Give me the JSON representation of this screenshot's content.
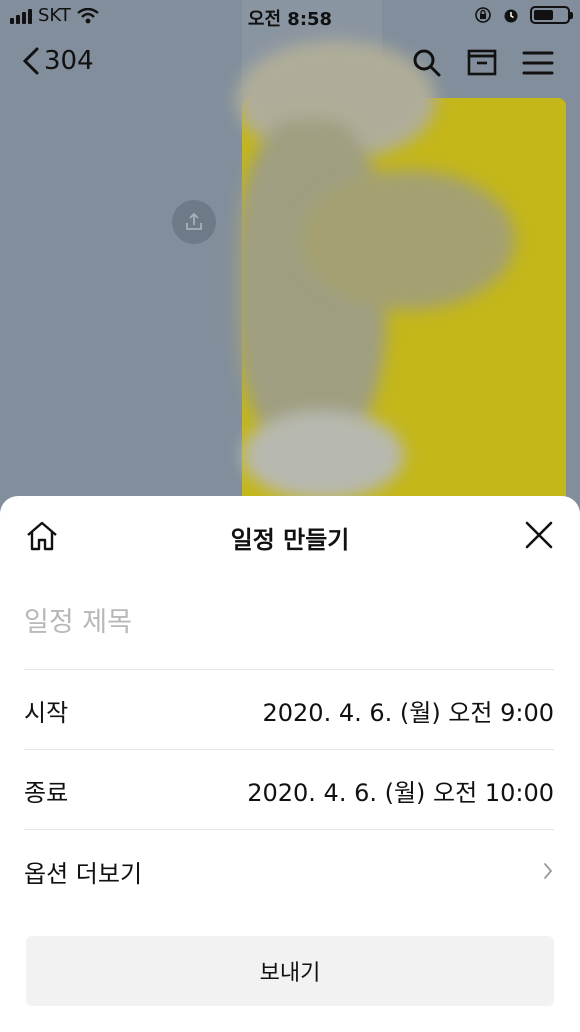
{
  "status_bar": {
    "carrier": "SKT",
    "time": "오전 8:58"
  },
  "chat": {
    "back_label": "304",
    "icons": [
      "search-icon",
      "archive-icon",
      "menu-icon"
    ]
  },
  "sheet": {
    "title": "일정 만들기",
    "title_placeholder": "일정 제목",
    "title_value": "",
    "rows": [
      {
        "label": "시작",
        "value": "2020. 4. 6. (월) 오전 9:00"
      },
      {
        "label": "종료",
        "value": "2020. 4. 6. (월) 오전 10:00"
      }
    ],
    "more_options_label": "옵션 더보기",
    "send_label": "보내기"
  },
  "colors": {
    "accent_yellow": "#f5df00",
    "chat_background": "#9aa7b4",
    "send_button_bg": "#f2f2f2",
    "placeholder": "#b8b8b8"
  }
}
